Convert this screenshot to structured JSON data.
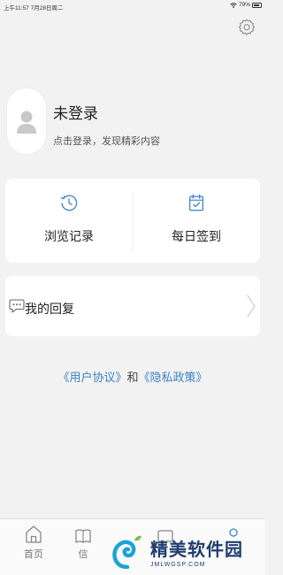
{
  "status_bar": {
    "time_date": "上午11:57  7月28日周二",
    "battery": "79%",
    "battery_level": 0.79
  },
  "profile": {
    "title": "未登录",
    "subtitle": "点击登录，发现精彩内容"
  },
  "quick_actions": [
    {
      "label": "浏览记录",
      "icon": "clock-history-icon"
    },
    {
      "label": "每日签到",
      "icon": "calendar-check-icon"
    }
  ],
  "menu": {
    "reply_label": "我的回复",
    "reply_icon": "chat-bubble-icon"
  },
  "agreement": {
    "user_agreement": "《用户协议》",
    "and": "和",
    "privacy_policy": "《隐私政策》"
  },
  "tab_bar": {
    "home": "首页",
    "second": "信"
  },
  "watermark": {
    "title": "精美软件园",
    "url": "JMLWGSP.COM"
  },
  "colors": {
    "accent": "#3b83c4",
    "background": "#f2f2f2",
    "card": "#ffffff"
  }
}
